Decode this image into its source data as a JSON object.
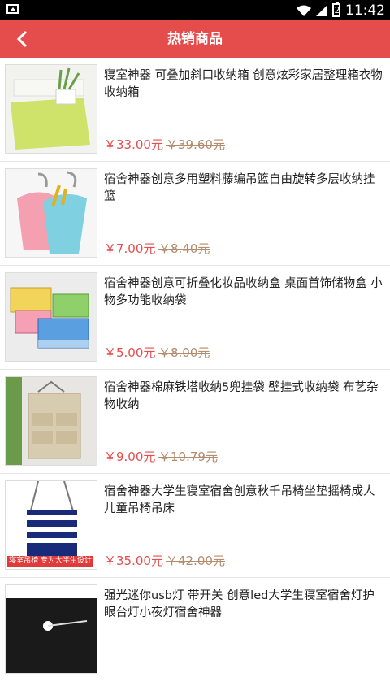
{
  "status_bar": {
    "time": "11:42",
    "battery": "2"
  },
  "header": {
    "title": "热销商品",
    "back_icon": "chevron-left-icon"
  },
  "colors": {
    "accent": "#e54d4d",
    "original_price": "#b38b6d"
  },
  "products": [
    {
      "name": "寝室神器 可叠加斜口收纳箱 创意炫彩家居整理箱衣物收纳箱",
      "price": "￥33.00元",
      "original_price": "￥39.60元"
    },
    {
      "name": "宿舍神器创意多用塑料藤编吊篮自由旋转多层收纳挂篮",
      "price": "￥7.00元",
      "original_price": "￥8.40元"
    },
    {
      "name": "宿舍神器创意可折叠化妆品收纳盒 桌面首饰储物盒 小物多功能收纳袋",
      "price": "￥5.00元",
      "original_price": "￥8.00元"
    },
    {
      "name": "宿舍神器棉麻铁塔收纳5兜挂袋 壁挂式收纳袋 布艺杂物收纳",
      "price": "￥9.00元",
      "original_price": "￥10.79元"
    },
    {
      "name": "宿舍神器大学生寝室宿舍创意秋千吊椅坐垫摇椅成人儿童吊椅吊床",
      "price": "￥35.00元",
      "original_price": "￥42.00元",
      "image_caption": "寝室吊椅  专为大学生设计"
    },
    {
      "name": "强光迷你usb灯 带开关 创意led大学生寝室宿舍灯护眼台灯小夜灯宿舍神器"
    }
  ]
}
